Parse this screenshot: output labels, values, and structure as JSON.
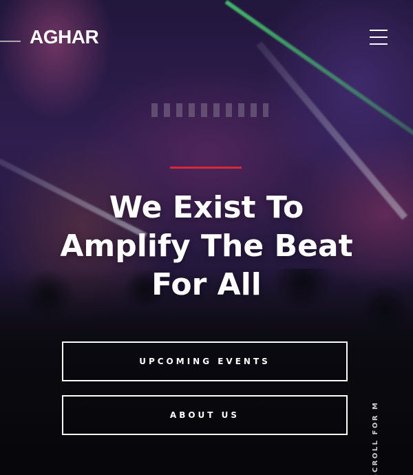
{
  "brand": {
    "logo_text": "AGHAR"
  },
  "colors": {
    "accent": "#d9283a"
  },
  "header": {
    "menu_icon": "hamburger-icon"
  },
  "hero": {
    "headline_lines": [
      "We Exist To",
      "Amplify The Beat",
      "For All"
    ]
  },
  "actions": {
    "upcoming_events_label": "UPCOMING EVENTS",
    "about_us_label": "ABOUT US"
  },
  "scroll_hint": {
    "text": "SCROLL FOR MORE"
  }
}
